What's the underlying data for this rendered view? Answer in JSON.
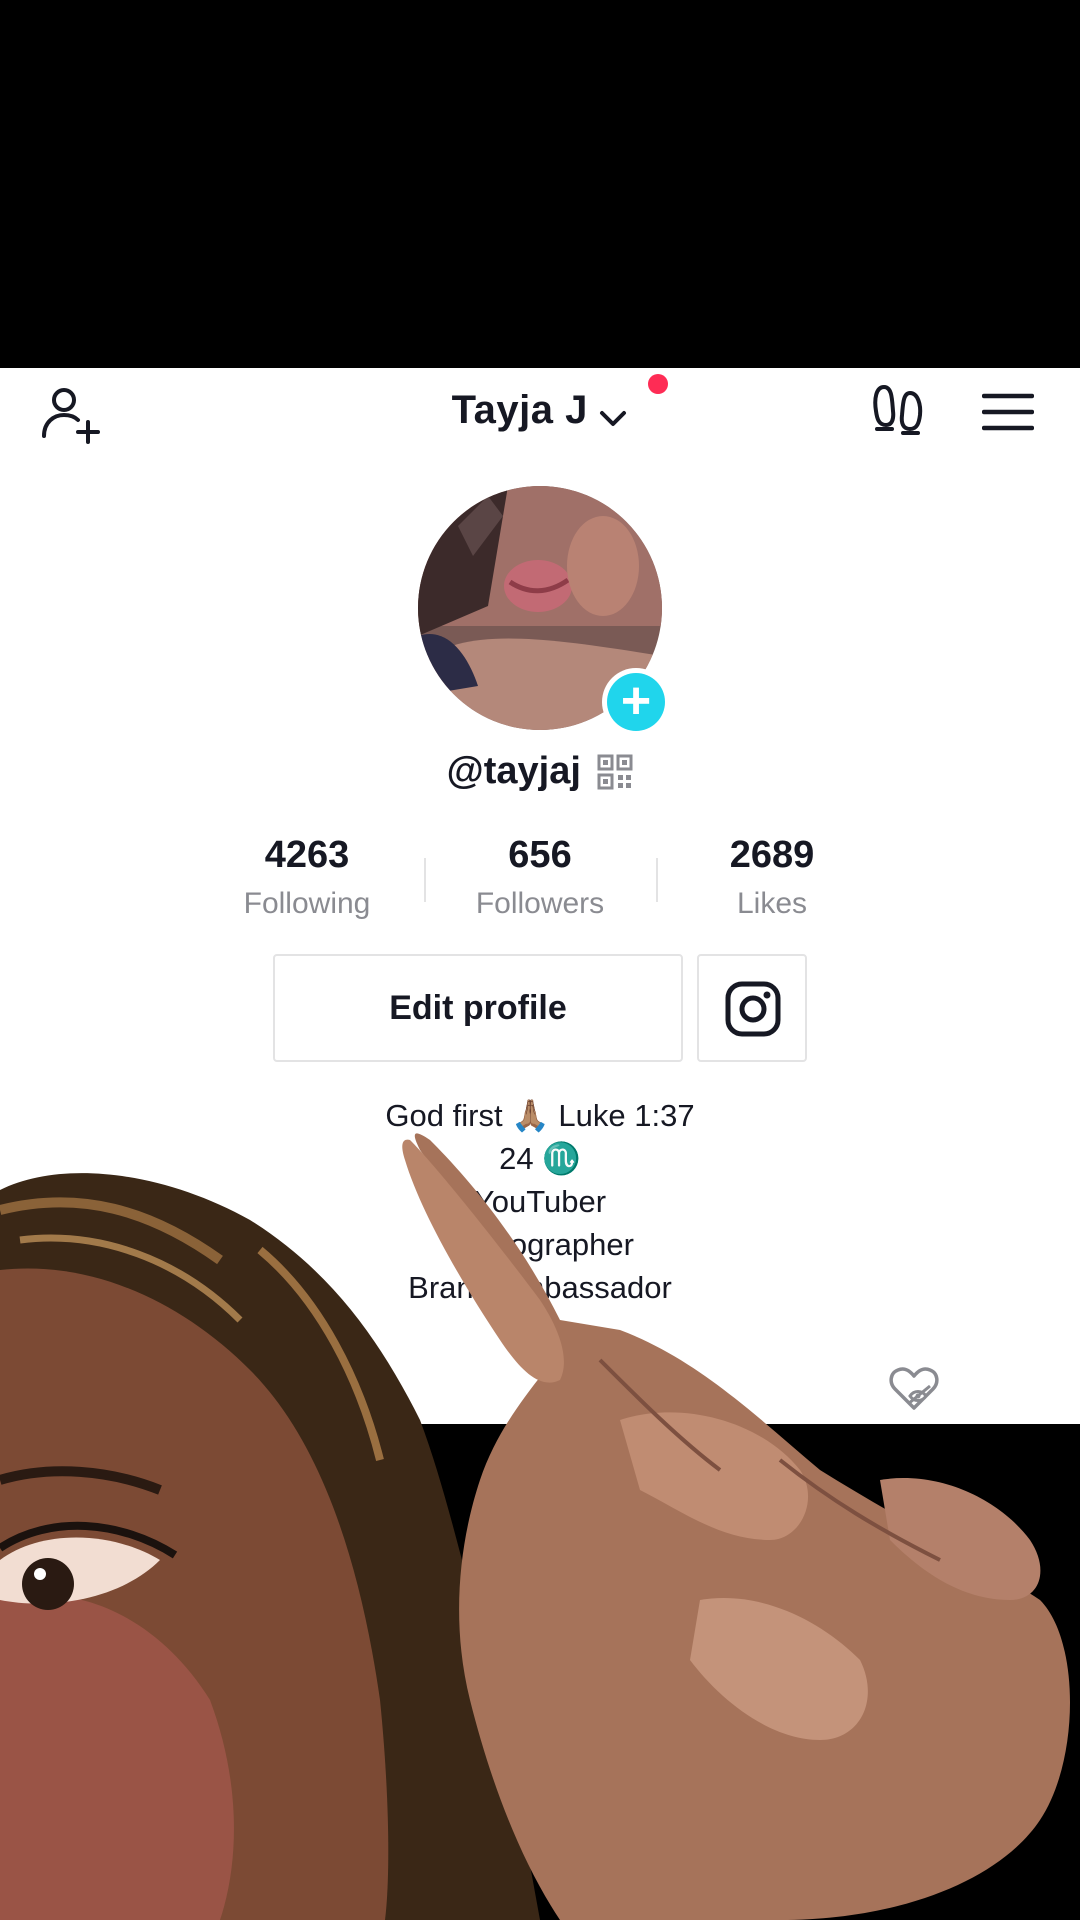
{
  "header": {
    "title": "Tayja J",
    "add_user_icon": "person-plus-icon",
    "footprint_icon": "footprints-icon",
    "menu_icon": "hamburger-menu-icon"
  },
  "profile": {
    "handle": "@tayjaj",
    "qr_icon": "qr-code-icon"
  },
  "stats": [
    {
      "value": "4263",
      "label": "Following"
    },
    {
      "value": "656",
      "label": "Followers"
    },
    {
      "value": "2689",
      "label": "Likes"
    }
  ],
  "actions": {
    "edit_profile": "Edit profile",
    "instagram_icon": "instagram-icon"
  },
  "bio": [
    "God first 🙏🏽 Luke 1:37",
    "24 ♏",
    "YouTuber",
    "Photographer",
    "Brand Ambassador"
  ],
  "colors": {
    "accent_teal": "#20d5ec",
    "notification_red": "#fe2c55",
    "text_primary": "#161823",
    "text_secondary": "#8a8b91"
  }
}
